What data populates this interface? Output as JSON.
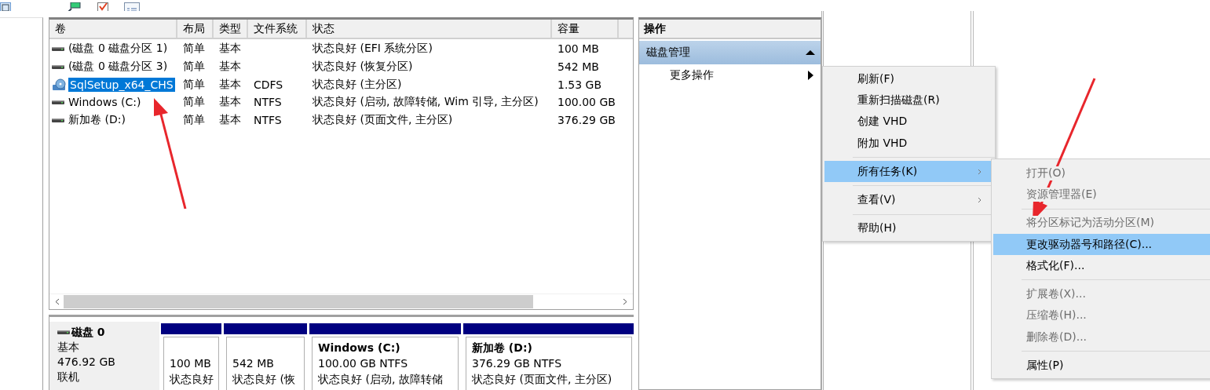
{
  "volume_list": {
    "columns": [
      "卷",
      "布局",
      "类型",
      "文件系统",
      "状态",
      "容量"
    ],
    "rows": [
      {
        "volume": "(磁盘 0 磁盘分区 1)",
        "kind": "disk",
        "selected": false,
        "layout": "简单",
        "type": "基本",
        "status": "状态良好 (EFI 系统分区)",
        "capacity": "100 MB"
      },
      {
        "volume": "(磁盘 0 磁盘分区 3)",
        "kind": "disk",
        "selected": false,
        "layout": "简单",
        "type": "基本",
        "status": "状态良好 (恢复分区)",
        "capacity": "542 MB"
      },
      {
        "volume": "SqlSetup_x64_CHS",
        "kind": "optical",
        "selected": true,
        "layout": "简单",
        "type": "基本",
        "file_system": "CDFS",
        "status": "状态良好 (主分区)",
        "capacity": "1.53 GB"
      },
      {
        "volume": "Windows (C:)",
        "kind": "disk",
        "selected": false,
        "layout": "简单",
        "type": "基本",
        "file_system": "NTFS",
        "status": "状态良好 (启动, 故障转储, Wim 引导, 主分区)",
        "capacity": "100.00 GB"
      },
      {
        "volume": "新加卷 (D:)",
        "kind": "disk",
        "selected": false,
        "layout": "简单",
        "type": "基本",
        "file_system": "NTFS",
        "status": "状态良好 (页面文件, 主分区)",
        "capacity": "376.29 GB"
      }
    ]
  },
  "disk_map": {
    "disk": {
      "name": "磁盘 0",
      "type": "基本",
      "size": "476.92 GB",
      "state": "联机"
    },
    "partitions": [
      {
        "size": "100 MB",
        "status": "状态良好"
      },
      {
        "size": "542 MB",
        "status": "状态良好 (恢"
      },
      {
        "name": "Windows (C:)",
        "size": "100.00 GB NTFS",
        "status": "状态良好 (启动, 故障转储"
      },
      {
        "name": "新加卷 (D:)",
        "size": "376.29 GB NTFS",
        "status": "状态良好 (页面文件, 主分区)"
      }
    ]
  },
  "actions": {
    "title": "操作",
    "section": {
      "title": "磁盘管理",
      "expanded": true
    },
    "items": [
      {
        "label": "更多操作",
        "has_submenu": true
      }
    ]
  },
  "context_menu": {
    "items": [
      {
        "kind": "item",
        "label": "刷新(F)",
        "selected": false
      },
      {
        "kind": "item",
        "label": "重新扫描磁盘(R)",
        "selected": false
      },
      {
        "kind": "item",
        "label": "创建 VHD",
        "selected": false
      },
      {
        "kind": "item",
        "label": "附加 VHD",
        "selected": false
      },
      {
        "kind": "separator"
      },
      {
        "kind": "item",
        "label": "所有任务(K)",
        "selected": true,
        "has_submenu": true
      },
      {
        "kind": "separator"
      },
      {
        "kind": "item",
        "label": "查看(V)",
        "selected": false,
        "has_submenu": true
      },
      {
        "kind": "separator"
      },
      {
        "kind": "item",
        "label": "帮助(H)",
        "selected": false
      }
    ]
  },
  "submenu": {
    "items": [
      {
        "kind": "item",
        "label": "打开(O)",
        "selected": false,
        "disabled": true
      },
      {
        "kind": "item",
        "label": "资源管理器(E)",
        "selected": false,
        "disabled": true
      },
      {
        "kind": "separator"
      },
      {
        "kind": "item",
        "label": "将分区标记为活动分区(M)",
        "selected": false,
        "disabled": true
      },
      {
        "kind": "item",
        "label": "更改驱动器号和路径(C)...",
        "selected": true,
        "disabled": false
      },
      {
        "kind": "item",
        "label": "格式化(F)...",
        "selected": false,
        "disabled": false
      },
      {
        "kind": "separator"
      },
      {
        "kind": "item",
        "label": "扩展卷(X)...",
        "selected": false,
        "disabled": true
      },
      {
        "kind": "item",
        "label": "压缩卷(H)...",
        "selected": false,
        "disabled": true
      },
      {
        "kind": "item",
        "label": "删除卷(D)...",
        "selected": false,
        "disabled": true
      },
      {
        "kind": "separator"
      },
      {
        "kind": "item",
        "label": "属性(P)",
        "selected": false,
        "disabled": false
      }
    ]
  }
}
